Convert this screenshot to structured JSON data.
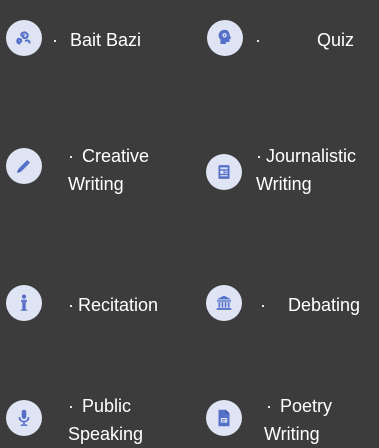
{
  "accent": "#5570c8",
  "icon_bg": "#dfe4f4",
  "activities": [
    {
      "id": "bait-bazi",
      "icon": "brain-swirl-icon",
      "dot": "·",
      "line1": "Bait Bazi",
      "line2": ""
    },
    {
      "id": "quiz",
      "icon": "head-idea-icon",
      "dot": "·",
      "line1": "Quiz",
      "line2": ""
    },
    {
      "id": "creative-writing",
      "icon": "pencil-icon",
      "dot": "·",
      "line1": "Creative",
      "line2": "Writing"
    },
    {
      "id": "journalistic-writing",
      "icon": "newspaper-icon",
      "dot": "·",
      "line1": "Journalistic",
      "line2": "Writing"
    },
    {
      "id": "recitation",
      "icon": "speaker-person-icon",
      "dot": "·",
      "line1": "Recitation",
      "line2": ""
    },
    {
      "id": "debating",
      "icon": "institution-icon",
      "dot": "·",
      "line1": "Debating",
      "line2": ""
    },
    {
      "id": "public-speaking",
      "icon": "microphone-icon",
      "dot": "·",
      "line1": "Public",
      "line2": "Speaking"
    },
    {
      "id": "poetry-writing",
      "icon": "document-icon",
      "dot": "·",
      "line1": "Poetry",
      "line2": "Writing"
    }
  ]
}
